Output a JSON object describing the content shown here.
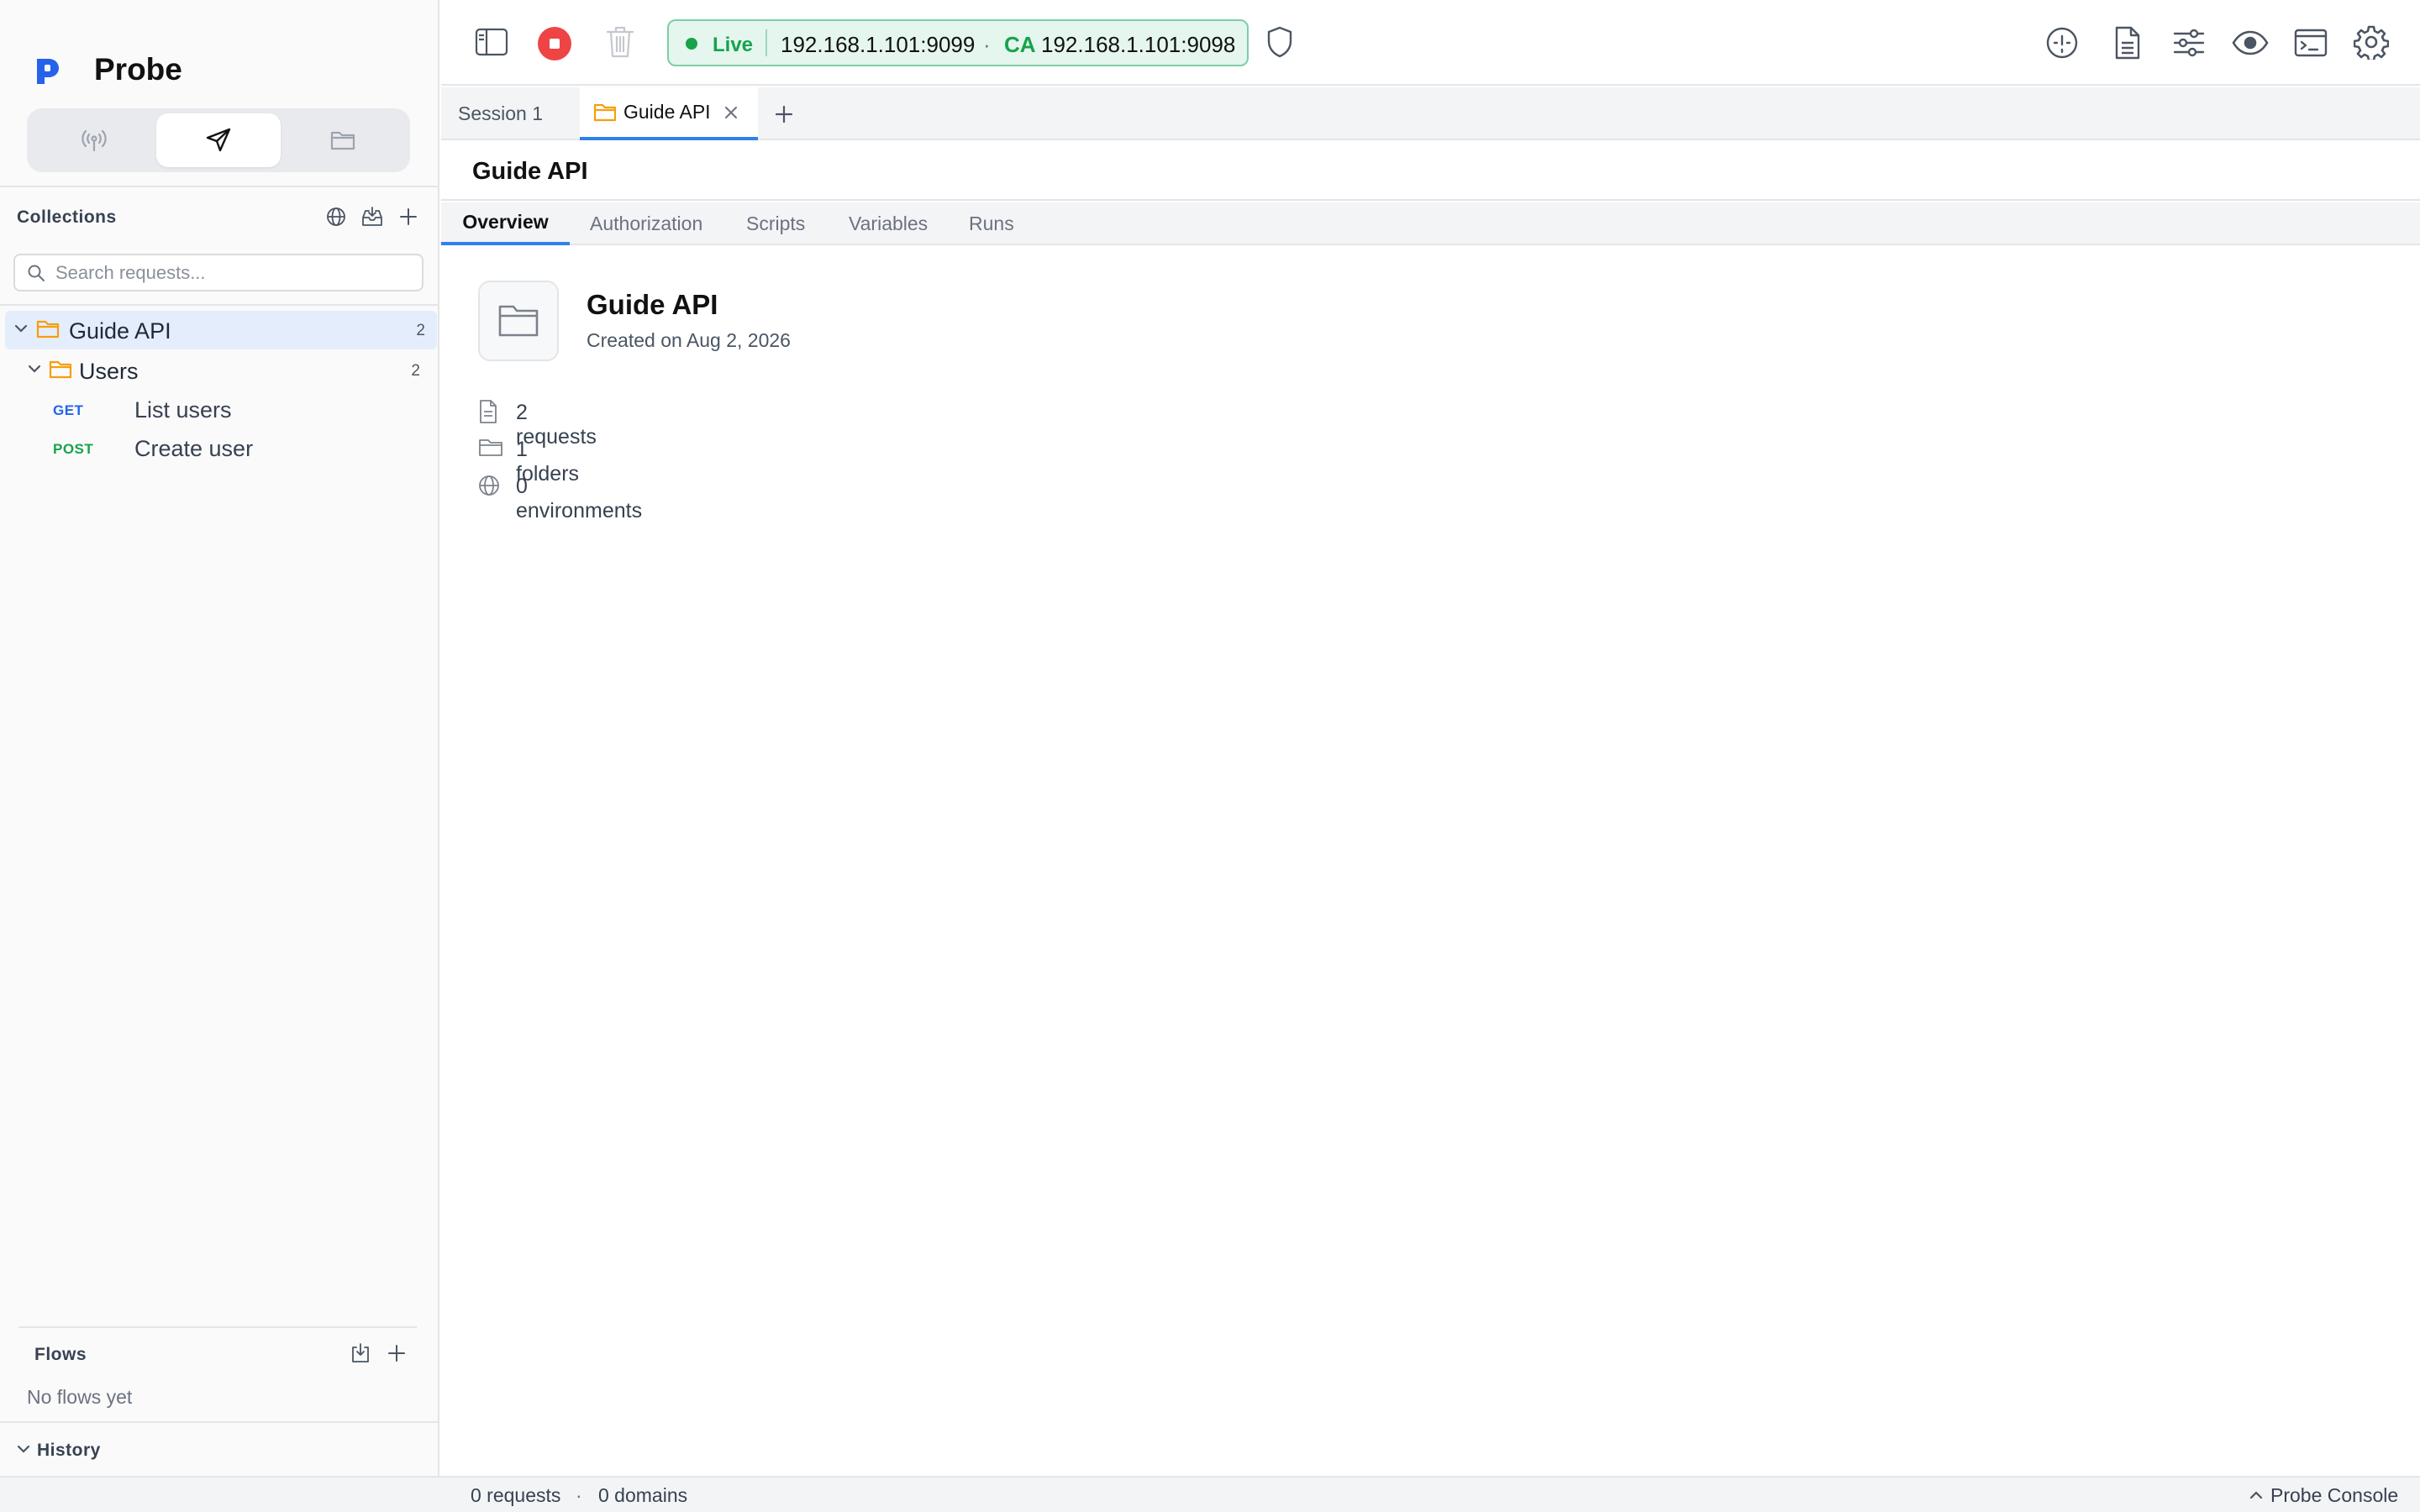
{
  "app": {
    "name": "Probe"
  },
  "sidebar": {
    "collections_title": "Collections",
    "search_placeholder": "Search requests...",
    "tree": {
      "collection": {
        "name": "Guide API",
        "count": "2"
      },
      "folder": {
        "name": "Users",
        "count": "2"
      },
      "requests": [
        {
          "method": "GET",
          "name": "List users"
        },
        {
          "method": "POST",
          "name": "Create user"
        }
      ]
    },
    "flows_title": "Flows",
    "flows_empty": "No flows yet",
    "history_title": "History"
  },
  "toolbar": {
    "live_label": "Live",
    "proxy_address": "192.168.1.101:9099",
    "separator": "·",
    "ca_label": "CA",
    "ca_address": "192.168.1.101:9098"
  },
  "tabs": [
    {
      "label": "Session 1"
    },
    {
      "label": "Guide API"
    }
  ],
  "page": {
    "title": "Guide API",
    "subtabs": [
      "Overview",
      "Authorization",
      "Scripts",
      "Variables",
      "Runs"
    ],
    "overview": {
      "name": "Guide API",
      "created": "Created on Aug 2, 2026",
      "stats": {
        "requests": "2 requests",
        "folders": "1 folders",
        "environments": "0 environments"
      }
    }
  },
  "status": {
    "requests": "0 requests",
    "dot": "·",
    "domains": "0 domains",
    "console": "Probe Console"
  },
  "colors": {
    "accent": "#2f80ed",
    "live_green": "#16a34a",
    "folder_orange": "#f59e0b",
    "record_red": "#ef4444"
  }
}
